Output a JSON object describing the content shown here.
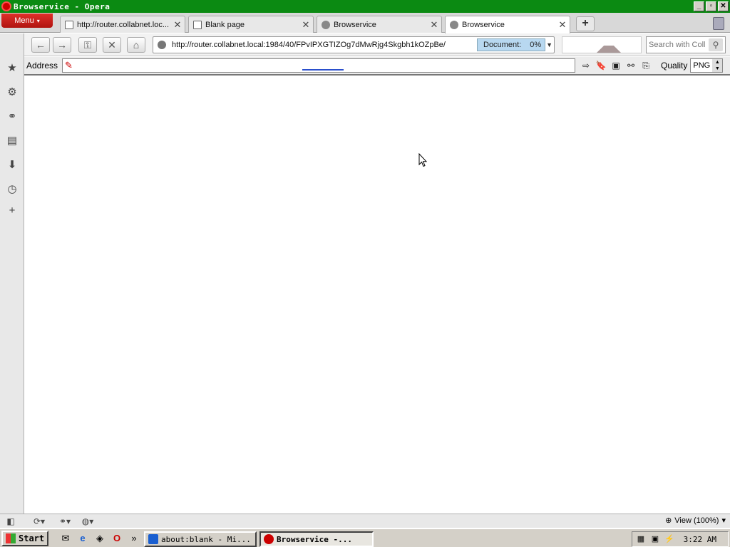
{
  "window": {
    "title": "Browservice - Opera",
    "min_glyph": "_",
    "max_glyph": "▫",
    "close_glyph": "✕"
  },
  "menu": {
    "label": "Menu"
  },
  "tabs": [
    {
      "label": "http://router.collabnet.loc...",
      "icon": "page-icon",
      "close": "✕"
    },
    {
      "label": "Blank page",
      "icon": "blank-page-icon",
      "close": "✕"
    },
    {
      "label": "Browservice",
      "icon": "globe-icon",
      "close": "✕"
    },
    {
      "label": "Browservice",
      "icon": "globe-icon",
      "close": "✕",
      "active": true
    }
  ],
  "newtab": {
    "glyph": "+"
  },
  "nav": {
    "back_glyph": "←",
    "forward_glyph": "→",
    "key_glyph": "⚿",
    "stop_glyph": "✕",
    "home_glyph": "⌂",
    "url": "http://router.collabnet.local:1984/40/FPvIPXGTIZOg7dMwRjg4Skgbh1kOZpBe/",
    "doc_label": "Document:",
    "doc_percent": "0%",
    "dropdown_glyph": "▼"
  },
  "search": {
    "placeholder": "Search with Coll",
    "glyph": "⚲"
  },
  "address": {
    "label": "Address",
    "value": "",
    "no_icon_glyph": "✎",
    "buttons": [
      "⇨",
      "🔖",
      "▣",
      "⚯",
      "⎘"
    ],
    "quality_label": "Quality",
    "quality_value": "PNG",
    "spin_up": "▲",
    "spin_down": "▼"
  },
  "sidebar": {
    "items": [
      {
        "name": "bookmarks-icon",
        "glyph": "★"
      },
      {
        "name": "settings-icon",
        "glyph": "⚙"
      },
      {
        "name": "unite-icon",
        "glyph": "⚭"
      },
      {
        "name": "notes-icon",
        "glyph": "▤"
      },
      {
        "name": "downloads-icon",
        "glyph": "⬇"
      },
      {
        "name": "history-icon",
        "glyph": "◷"
      },
      {
        "name": "add-panel-icon",
        "glyph": "+"
      }
    ]
  },
  "statusbar": {
    "panel_toggle": "◧",
    "sync": "⟳▾",
    "unite": "⚭▾",
    "turbo": "◍▾",
    "zoom_glyph": "⊕",
    "zoom_label": "View (100%)",
    "zoom_drop": "▾"
  },
  "taskbar": {
    "start_label": "Start",
    "quicklaunch": [
      "✉",
      "e",
      "◈",
      "O"
    ],
    "chevron": "»",
    "items": [
      {
        "label": "about:blank - Mi...",
        "active": false
      },
      {
        "label": "Browservice -...",
        "active": true
      }
    ],
    "tray": [
      "▦",
      "▣",
      "⚡"
    ],
    "clock": "3:22 AM"
  }
}
